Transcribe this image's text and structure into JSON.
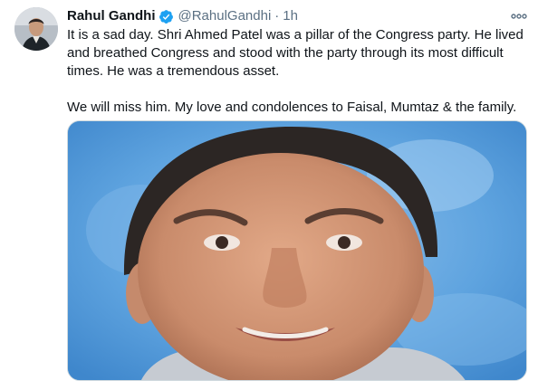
{
  "tweet": {
    "author_name": "Rahul Gandhi",
    "author_handle": "@RahulGandhi",
    "separator": "·",
    "timestamp": "1h",
    "text_paragraphs": [
      "It is a sad day. Shri Ahmed Patel was a pillar of the Congress party. He lived and breathed Congress and stood with the party through its most difficult times. He was a tremendous asset.",
      "We will miss him. My love and condolences to Faisal, Mumtaz & the family."
    ],
    "avatar_icon": "profile-photo",
    "verified_icon": "verified-badge-icon",
    "more_icon": "more-options-icon",
    "media_description_icon": "portrait-photo"
  },
  "colors": {
    "verified_blue": "#1da1f2",
    "secondary_text": "#5b7083",
    "primary_text": "#0f1419",
    "photo_background": "#4e95d6"
  }
}
